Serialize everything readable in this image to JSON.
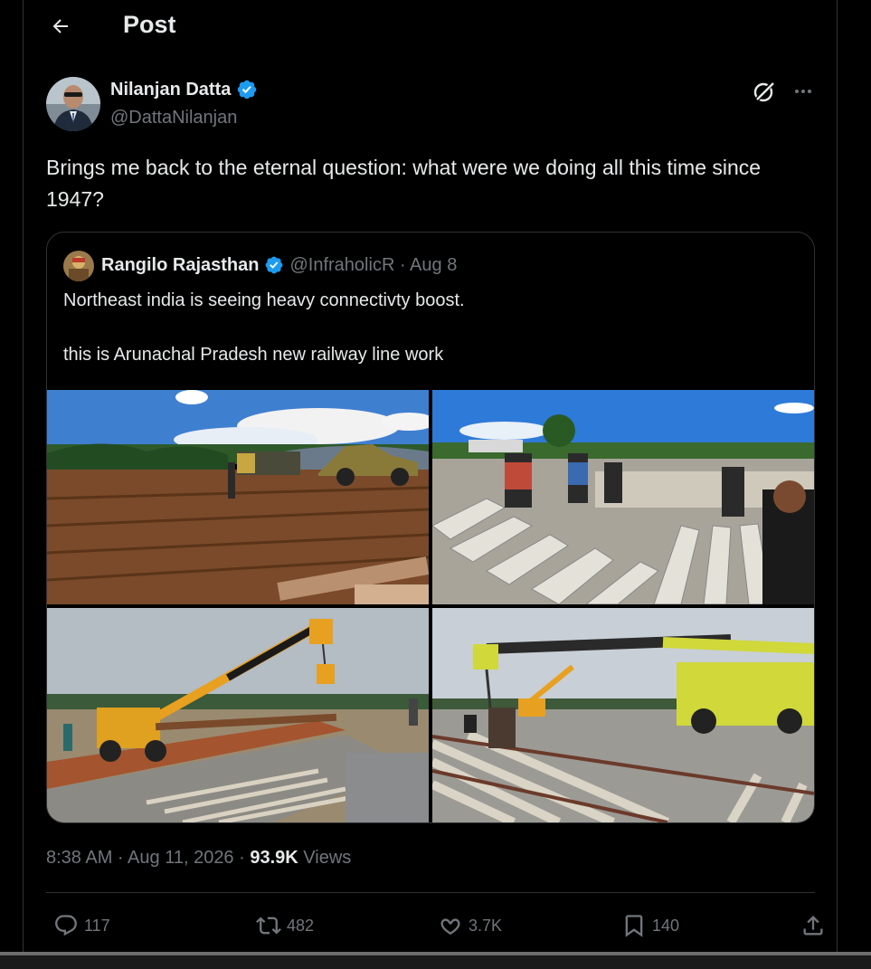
{
  "header": {
    "title": "Post"
  },
  "author": {
    "name": "Nilanjan Datta",
    "handle": "@DattaNilanjan"
  },
  "tweet": {
    "text": "Brings me back to the eternal question: what were we doing all this time since 1947?"
  },
  "quote": {
    "name": "Rangilo Rajasthan",
    "meta": "@InfraholicR · Aug 8",
    "text1": "Northeast india is seeing heavy connectivty boost.",
    "text2": "this is Arunachal Pradesh new railway line work"
  },
  "stats": {
    "time": "8:38 AM · Aug 11, 2026 · ",
    "views_count": "93.9K",
    "views_label": " Views"
  },
  "actions": {
    "replies": "117",
    "reposts": "482",
    "likes": "3.7K",
    "bookmarks": "140"
  },
  "colors": {
    "background": "#000000",
    "text": "#e7e9ea",
    "muted": "#71767b",
    "border": "#2f3336",
    "verified": "#1d9bf0"
  }
}
